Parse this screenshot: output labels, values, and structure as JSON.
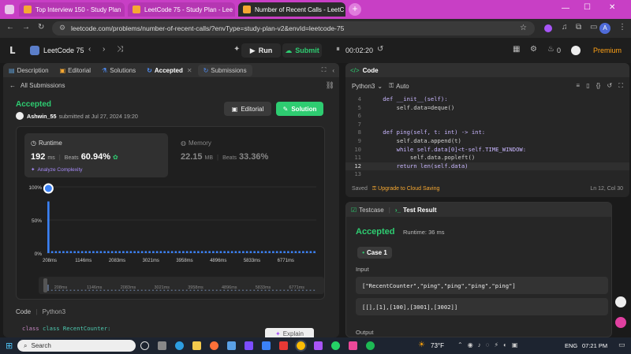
{
  "browser": {
    "tabs": [
      {
        "title": "Top Interview 150 - Study Plan",
        "color": "#f6a832",
        "active": false
      },
      {
        "title": "LeetCode 75 - Study Plan - Lee",
        "color": "#f6a832",
        "active": false
      },
      {
        "title": "Number of Recent Calls - LeetC",
        "color": "#f6a832",
        "active": true
      }
    ],
    "url": "leetcode.com/problems/number-of-recent-calls/?envType=study-plan-v2&envId=leetcode-75",
    "profile": "A"
  },
  "lcnav": {
    "plan": "LeetCode 75",
    "run": "Run",
    "submit": "Submit",
    "timer": "00:02:20",
    "streak": "0",
    "premium": "Premium"
  },
  "left": {
    "tabs": [
      "Description",
      "Editorial",
      "Solutions",
      "Accepted",
      "Submissions"
    ],
    "back": "All Submissions",
    "status": "Accepted",
    "user": "Ashwin_55",
    "submitted": "submitted at Jul 27, 2024 19:20",
    "editorial_btn": "Editorial",
    "solution_btn": "Solution",
    "runtime": {
      "label": "Runtime",
      "value": "192",
      "unit": "ms",
      "beats_label": "Beats",
      "beats": "60.94%",
      "analyze": "Analyze Complexity"
    },
    "memory": {
      "label": "Memory",
      "value": "22.15",
      "unit": "MB",
      "beats_label": "Beats",
      "beats": "33.36%"
    },
    "code_label": "Code",
    "code_lang": "Python3",
    "code_line": "class RecentCounter:",
    "explain": "Explain"
  },
  "chart_data": {
    "type": "bar",
    "y_ticks": [
      "100%",
      "50%",
      "0%"
    ],
    "x_ticks": [
      "208ms",
      "1146ms",
      "2083ms",
      "3021ms",
      "3958ms",
      "4896ms",
      "5833ms",
      "6771ms"
    ],
    "ylim": [
      0,
      100
    ],
    "highlight_percent": 100,
    "values": [
      78,
      3,
      3,
      3,
      3,
      3,
      3,
      3,
      3,
      3,
      3,
      3,
      3,
      3,
      3,
      3,
      3,
      3,
      3,
      3,
      3,
      3,
      3,
      3,
      3,
      3,
      3,
      3,
      3,
      3,
      3,
      3,
      3,
      3,
      3,
      3,
      3,
      3,
      3,
      3,
      3,
      3,
      3,
      3,
      3,
      3,
      3,
      3,
      3,
      3,
      3,
      3,
      3,
      3,
      3,
      3,
      3,
      3,
      3,
      3,
      3,
      3,
      3,
      3,
      3,
      3,
      3,
      3,
      3,
      3,
      3,
      3
    ],
    "bar_color": "#3b82f6"
  },
  "right": {
    "header": "Code",
    "lang": "Python3",
    "auto": "Auto",
    "code_lines": [
      {
        "n": "4",
        "text": "    def __init__(self):"
      },
      {
        "n": "5",
        "text": "        self.data=deque()"
      },
      {
        "n": "6",
        "text": ""
      },
      {
        "n": "7",
        "text": ""
      },
      {
        "n": "8",
        "text": "    def ping(self, t: int) -> int:"
      },
      {
        "n": "9",
        "text": "        self.data.append(t)"
      },
      {
        "n": "10",
        "text": "        while self.data[0]<t-self.TIME_WINDOW:"
      },
      {
        "n": "11",
        "text": "            self.data.popleft()"
      },
      {
        "n": "12",
        "text": "        return len(self.data)"
      },
      {
        "n": "13",
        "text": ""
      }
    ],
    "saved": "Saved",
    "upgrade": "Upgrade to Cloud Saving",
    "position": "Ln 12, Col 30",
    "testcase": "Testcase",
    "test_result": "Test Result",
    "result": "Accepted",
    "result_runtime": "Runtime: 36 ms",
    "case": "Case 1",
    "input_label": "Input",
    "input1": "[\"RecentCounter\",\"ping\",\"ping\",\"ping\",\"ping\"]",
    "input2": "[[],[1],[100],[3001],[3002]]",
    "output_label": "Output"
  },
  "taskbar": {
    "search": "Search",
    "temp": "73°F",
    "lang": "ENG",
    "time": "07:21 PM"
  }
}
